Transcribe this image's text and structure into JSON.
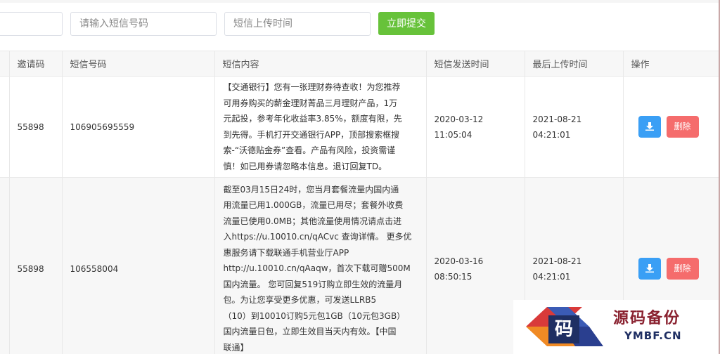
{
  "search": {
    "first_placeholder": "",
    "sms_placeholder": "请输入短信号码",
    "time_placeholder": "短信上传时间",
    "submit_label": "立即提交"
  },
  "table": {
    "headers": [
      "邀请码",
      "短信号码",
      "短信内容",
      "短信发送时间",
      "最后上传时间",
      "操作"
    ],
    "rows": [
      {
        "invite_code": "55898",
        "sms_number": "106905695559",
        "content_lines": [
          "【交通银行】您有一张理财券待查收！为您推荐",
          "可用券购买的薪金理财菁品三月理财产品，1万",
          "元起投，参考年化收益率3.85%，额度有限，先",
          "到先得。手机打开交通银行APP，顶部搜索框搜",
          "索-“沃德贴金券”查看。产品有风险，投资需谨",
          "慎！如已用券请忽略本信息。退订回复TD。"
        ],
        "sent_date": "2020-03-12",
        "sent_clock": "11:05:04",
        "upload_date": "2021-08-21",
        "upload_clock": "04:21:01",
        "delete_label": "删除"
      },
      {
        "invite_code": "55898",
        "sms_number": "106558004",
        "content_lines": [
          "截至03月15日24时，您当月套餐流量内国内通",
          "用流量已用1.000GB，流量已用尽；套餐外收费",
          "流量已使用0.0MB；其他流量使用情况请点击进",
          "入https://u.10010.cn/qACvc 查询详情。 更多优",
          "惠服务请下载联通手机营业厅APP",
          "http://u.10010.cn/qAaqw，首次下载可赠500M",
          "国内流量。 您可回复519订购立即生效的流量月",
          "包。为让您享受更多优惠，可发送LLRB5",
          "（10）到10010订购5元包1GB（10元包3GB）",
          "国内流量日包，立即生效目当天内有效。【中国",
          "联通】"
        ],
        "sent_date": "2020-03-16",
        "sent_clock": "08:50:15",
        "upload_date": "2021-08-21",
        "upload_clock": "04:21:01",
        "delete_label": "删除"
      }
    ]
  },
  "watermark": {
    "logo_char": "码",
    "title": "源码备份",
    "subtitle": "YMBF.CN"
  },
  "icons": {
    "download": "download-icon"
  }
}
